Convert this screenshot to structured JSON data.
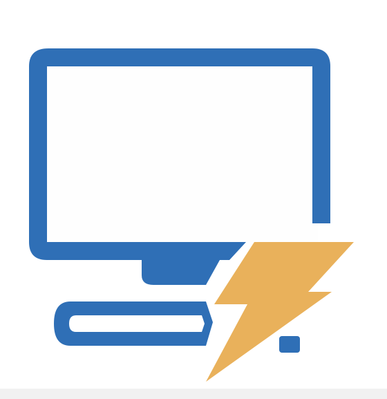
{
  "icon": {
    "name": "computer-power-icon",
    "monitor_color": "#2f6fb6",
    "bolt_color": "#e9b15b",
    "background": "#ffffff",
    "screen_fill": "#fefefe"
  }
}
